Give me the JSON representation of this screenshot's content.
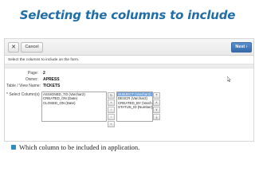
{
  "slide": {
    "title": "Selecting the columns to include",
    "bullet": "Which column to be included in application."
  },
  "toolbar": {
    "close_label": "✕",
    "cancel_label": "Cancel",
    "next_label": "Next",
    "next_arrow": "›"
  },
  "form": {
    "instruction": "Select the columns to include on the form.",
    "page_label": "Page:",
    "page_value": "2",
    "owner_label": "Owner:",
    "owner_value": "APRESS",
    "table_label": "Table / View Name:",
    "table_value": "TICKETS",
    "columns_label": "* Select Column(s)"
  },
  "available_columns": [
    "ASSIGNED_TO (Varchar2)",
    "CREATED_ON (Date)",
    "CLOSED_ON (Date)"
  ],
  "selected_columns": [
    "SUBJECT (Varchar2)",
    "DESCR (Varchar2)",
    "CREATED_BY (Varchar2)",
    "STATUS_ID (Number)"
  ],
  "shuttle_buttons": [
    "↻",
    "»",
    "›",
    "‹",
    "«"
  ],
  "order_buttons": [
    "⤒",
    "∧",
    "∨",
    "⤓"
  ],
  "colors": {
    "title": "#1f6ea8",
    "next_button": "#336aa8",
    "selected_row": "#6f9fd8",
    "bullet": "#2d8bbf"
  },
  "icons": {
    "close": "close-icon",
    "bullet": "square-bullet-icon",
    "cursor": "mouse-pointer-icon"
  }
}
